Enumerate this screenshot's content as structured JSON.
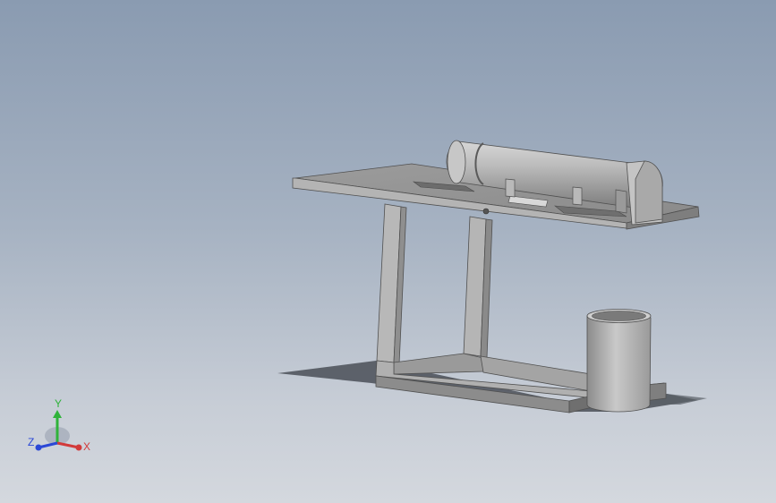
{
  "viewport": {
    "background_top": "#8a9bb1",
    "background_bottom": "#d4d8de"
  },
  "model": {
    "body_color": "#a8a8a8",
    "shadow_color": "#4a4f57"
  },
  "triad": {
    "x_label": "X",
    "y_label": "Y",
    "z_label": "Z",
    "x_color": "#d23a3a",
    "y_color": "#2fb33a",
    "z_color": "#2b48d6"
  }
}
